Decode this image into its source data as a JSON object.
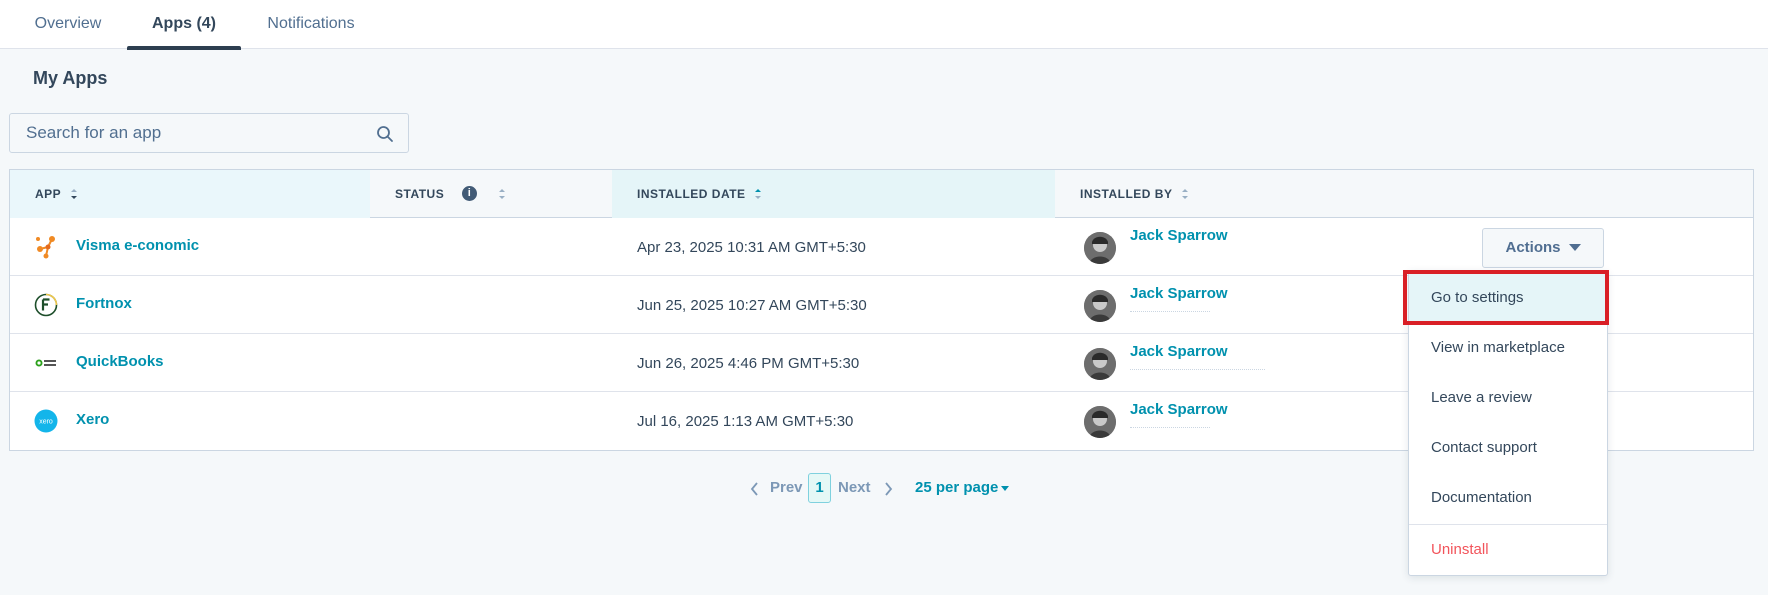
{
  "tabs": [
    {
      "label": "Overview",
      "active": false
    },
    {
      "label": "Apps (4)",
      "active": true
    },
    {
      "label": "Notifications",
      "active": false
    }
  ],
  "page_title": "My Apps",
  "search": {
    "placeholder": "Search for an app",
    "value": ""
  },
  "table": {
    "columns": [
      {
        "label": "APP",
        "sort": "desc"
      },
      {
        "label": "STATUS",
        "sort": "none",
        "has_info": true
      },
      {
        "label": "INSTALLED DATE",
        "sort": "asc"
      },
      {
        "label": "INSTALLED BY",
        "sort": "none"
      }
    ],
    "rows": [
      {
        "app": "Visma e-conomic",
        "icon": "visma-logo-icon",
        "date": "Apr 23, 2025 10:31 AM GMT+5:30",
        "installed_by": "Jack Sparrow",
        "actions_label": "Actions"
      },
      {
        "app": "Fortnox",
        "icon": "fortnox-logo-icon",
        "date": "Jun 25, 2025 10:27 AM GMT+5:30",
        "installed_by": "Jack Sparrow"
      },
      {
        "app": "QuickBooks",
        "icon": "quickbooks-logo-icon",
        "date": "Jun 26, 2025 4:46 PM GMT+5:30",
        "installed_by": "Jack Sparrow"
      },
      {
        "app": "Xero",
        "icon": "xero-logo-icon",
        "date": "Jul 16, 2025 1:13 AM GMT+5:30",
        "installed_by": "Jack Sparrow"
      }
    ]
  },
  "actions_menu": {
    "items": [
      "Go to settings",
      "View in marketplace",
      "Leave a review",
      "Contact support",
      "Documentation"
    ],
    "danger_item": "Uninstall",
    "highlighted": "Go to settings"
  },
  "pagination": {
    "prev_label": "Prev",
    "current_page": "1",
    "next_label": "Next",
    "per_page_label": "25 per page"
  },
  "colors": {
    "link": "#0091ae",
    "text": "#33475b",
    "highlight": "#d91f26",
    "danger": "#f2545b",
    "tab_underline": "#2d3e50"
  }
}
